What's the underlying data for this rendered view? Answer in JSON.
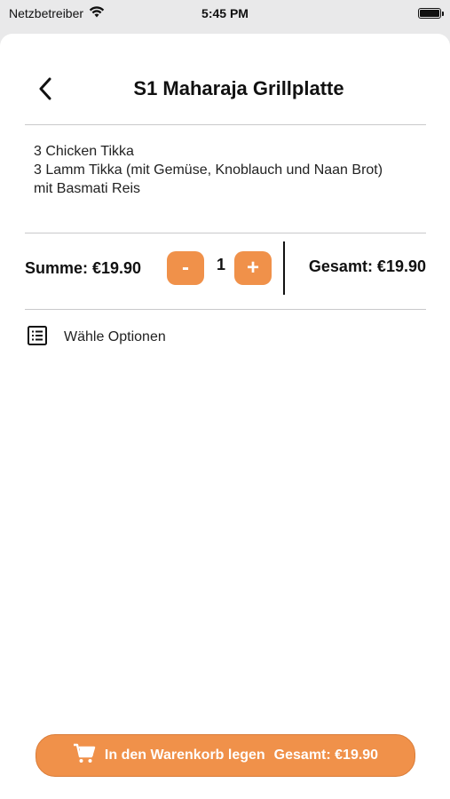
{
  "status_bar": {
    "carrier": "Netzbetreiber",
    "time": "5:45 PM",
    "wifi_icon": "wifi-icon",
    "battery_icon": "battery-icon"
  },
  "header": {
    "title": "S1 Maharaja Grillplatte",
    "back_icon": "chevron-left-icon"
  },
  "description": {
    "lines": [
      "3 Chicken Tikka",
      "3 Lamm Tikka (mit Gemüse, Knoblauch und Naan Brot)",
      "mit Basmati Reis"
    ]
  },
  "quantity": {
    "summe_label": "Summe: €19.90",
    "minus_label": "-",
    "value": "1",
    "plus_label": "+",
    "gesamt_label": "Gesamt: €19.90"
  },
  "options": {
    "label": "Wähle Optionen",
    "icon": "list-icon"
  },
  "cart_button": {
    "label": "In den Warenkorb legen",
    "total": "Gesamt: €19.90",
    "icon": "cart-icon"
  },
  "colors": {
    "accent": "#f0914a",
    "accent_border": "#d97c38",
    "divider": "#c9c9cb",
    "background": "#e9e9ea"
  }
}
